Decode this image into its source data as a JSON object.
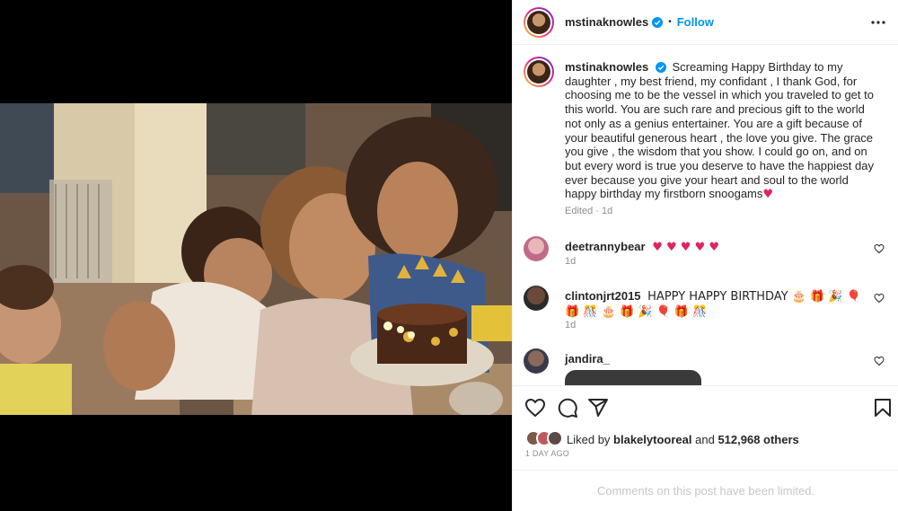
{
  "post": {
    "username": "mstinaknowles",
    "follow_label": "Follow",
    "separator": "•",
    "caption": "Screaming Happy Birthday to my daughter , my best friend, my confidant , I thank God, for choosing me to be the vessel in which you traveled to get to this world. You are such rare and precious gift to the world not only as a genius entertainer. You are a gift because of your beautiful generous heart , the love you give. The grace you give , the wisdom that you show. I could go on, and on but every word is true you deserve to have the happiest day ever because you give your heart and soul to the world happy birthday my firstborn snoogams",
    "caption_emoji": "♥",
    "caption_meta": "Edited · 1d",
    "accent_color": "#0095f6"
  },
  "comments": [
    {
      "username": "deetrannybear",
      "text": "♥ ♥ ♥ ♥ ♥",
      "meta": "1d"
    },
    {
      "username": "clintonjrt2015",
      "text": "HAPPY HAPPY BIRTHDAY 🎂 🎁 🎉 🎈 🎁 🎊 🎂 🎁 🎉 🎈 🎁 🎊",
      "meta": "1d"
    },
    {
      "username": "jandira_",
      "text": "",
      "meta": ""
    }
  ],
  "actions": {
    "like_icon": "heart-icon",
    "comment_icon": "comment-icon",
    "share_icon": "share-icon",
    "save_icon": "bookmark-icon"
  },
  "likes": {
    "prefix": "Liked by",
    "user": "blakelytooreal",
    "conjunction": "and",
    "count": "512,968 others"
  },
  "timestamp": "1 DAY AGO",
  "limited_notice": "Comments on this post have been limited."
}
